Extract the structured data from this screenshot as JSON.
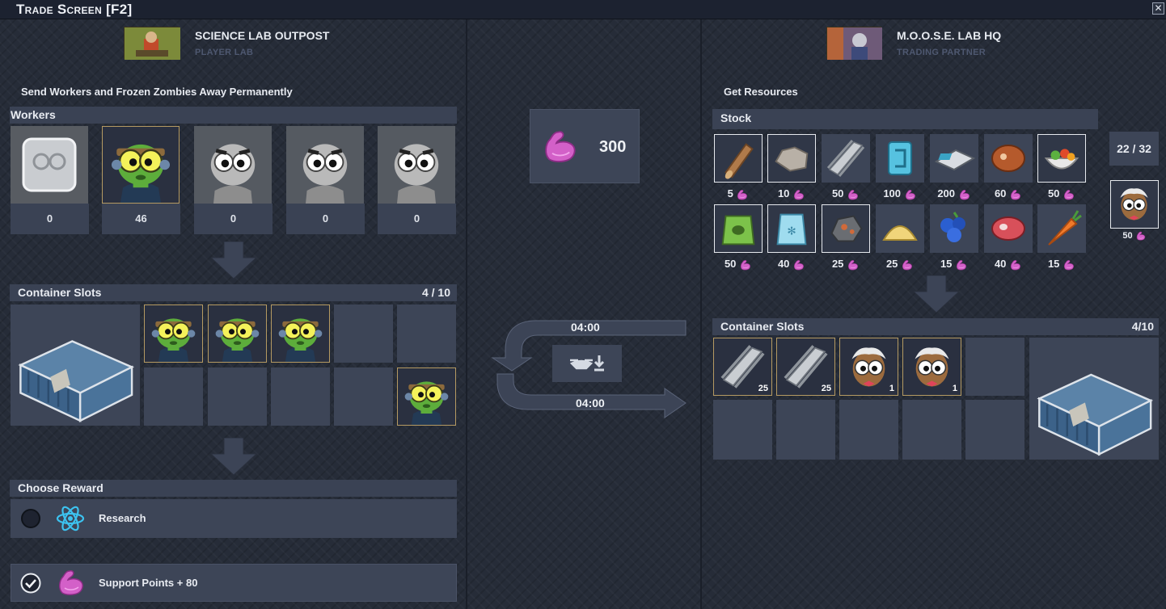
{
  "window": {
    "title": "Trade Screen [F2]",
    "close": "✕"
  },
  "player": {
    "name": "SCIENCE LAB OUTPOST",
    "subtitle": "PLAYER LAB"
  },
  "partner": {
    "name": "M.O.O.S.E. LAB HQ",
    "subtitle": "TRADING PARTNER"
  },
  "left": {
    "section_title": "Send Workers and Frozen Zombies Away Permanently",
    "workers_label": "Workers",
    "worker_counts": [
      "0",
      "46",
      "0",
      "0",
      "0"
    ],
    "container_label": "Container Slots",
    "container_count": "4 / 10",
    "reward_label": "Choose Reward",
    "rewards": [
      {
        "label": "Research",
        "selected": false,
        "icon": "atom-icon"
      },
      {
        "label": "Support Points + 80",
        "selected": true,
        "icon": "muscle-icon"
      }
    ]
  },
  "middle": {
    "support_value": "300",
    "timer_in": "04:00",
    "timer_out": "04:00"
  },
  "right": {
    "section_title": "Get Resources",
    "stock_label": "Stock",
    "capacity": "22 / 32",
    "stock_prices_row1": [
      "5",
      "10",
      "50",
      "100",
      "200",
      "60",
      "50"
    ],
    "stock_prices_row2": [
      "50",
      "40",
      "25",
      "25",
      "15",
      "40",
      "15"
    ],
    "stock_icons_row1": [
      "wood-log-icon",
      "stone-icon",
      "steel-beam-icon",
      "chemical-container-icon",
      "electronics-icon",
      "steak-icon",
      "salad-bowl-icon"
    ],
    "stock_icons_row2": [
      "seed-bag-icon",
      "ice-bag-icon",
      "ore-icon",
      "sand-icon",
      "blueberries-icon",
      "raw-meat-icon",
      "carrot-icon"
    ],
    "scientist_price": "50",
    "container_label": "Container Slots",
    "container_count": "4/10",
    "container_qty": [
      "25",
      "25",
      "1",
      "1"
    ]
  },
  "colors": {
    "panel": "#3a4254",
    "accent_gold": "#b59a62",
    "muscle": "#d65fc9"
  }
}
